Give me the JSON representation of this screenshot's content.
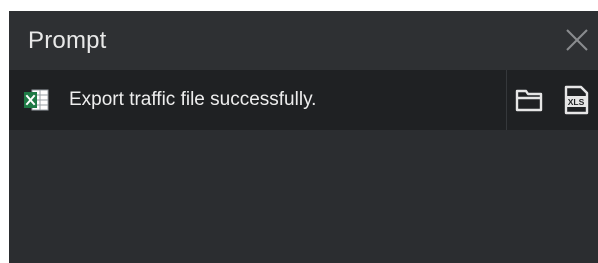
{
  "dialog": {
    "title": "Prompt",
    "close_icon": "close-icon"
  },
  "message": {
    "icon": "excel-file-icon",
    "text": "Export traffic file successfully.",
    "actions": {
      "open_folder_icon": "folder-icon",
      "open_xls_icon": "xls-file-icon",
      "xls_badge_text": "XLS"
    }
  },
  "colors": {
    "dialog_background": "#2b2d30",
    "row_background": "#1f2123",
    "text": "#eeeeee",
    "excel_green": "#1e7a45"
  }
}
